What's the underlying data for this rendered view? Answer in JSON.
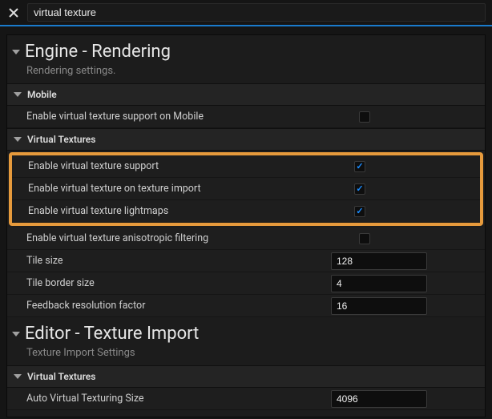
{
  "search": {
    "value": "virtual texture"
  },
  "sections": {
    "rendering": {
      "title": "Engine - Rendering",
      "description": "Rendering settings.",
      "groups": {
        "mobile": {
          "label": "Mobile",
          "rows": {
            "enable_mobile_vt": {
              "label": "Enable virtual texture support on Mobile",
              "checked": false
            }
          }
        },
        "vt": {
          "label": "Virtual Textures",
          "rows": {
            "enable_vt": {
              "label": "Enable virtual texture support",
              "checked": true
            },
            "enable_vt_import": {
              "label": "Enable virtual texture on texture import",
              "checked": true
            },
            "enable_vt_light": {
              "label": "Enable virtual texture lightmaps",
              "checked": true
            },
            "enable_vt_aniso": {
              "label": "Enable virtual texture anisotropic filtering",
              "checked": false
            },
            "tile_size": {
              "label": "Tile size",
              "value": "128"
            },
            "tile_border": {
              "label": "Tile border size",
              "value": "4"
            },
            "feedback_res": {
              "label": "Feedback resolution factor",
              "value": "16"
            }
          }
        }
      }
    },
    "texture_import": {
      "title": "Editor - Texture Import",
      "description": "Texture Import Settings",
      "groups": {
        "vt": {
          "label": "Virtual Textures",
          "rows": {
            "auto_vt_size": {
              "label": "Auto Virtual Texturing Size",
              "value": "4096"
            }
          }
        }
      }
    }
  }
}
